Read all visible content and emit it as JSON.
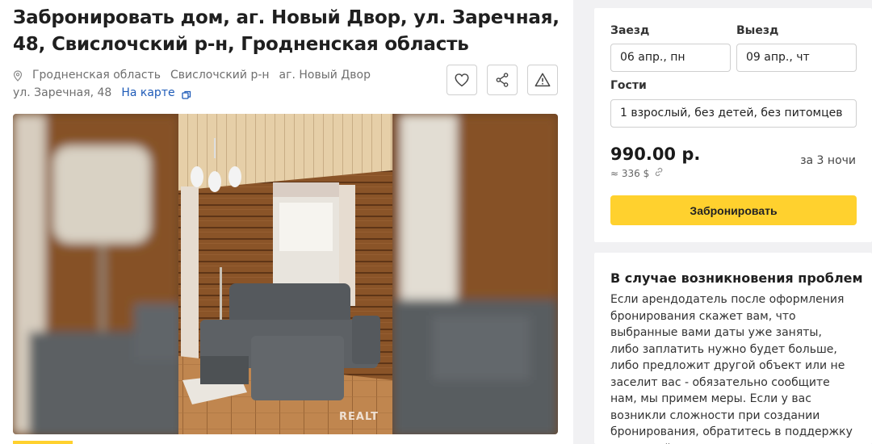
{
  "listing": {
    "title": "Забронировать дом, аг. Новый Двор, ул. Заречная, 48, Свислочский р-н, Гродненская область",
    "address": {
      "region": "Гродненская область",
      "district": "Свислочский р-н",
      "settlement": "аг. Новый Двор",
      "street": "ул. Заречная, 48",
      "map_link": "На карте"
    },
    "actions": [
      "heart-icon",
      "share-icon",
      "warning-icon"
    ],
    "watermark": "REALT"
  },
  "booking": {
    "checkin_label": "Заезд",
    "checkin_value": "06 апр., пн",
    "checkout_label": "Выезд",
    "checkout_value": "09 апр., чт",
    "guests_label": "Гости",
    "guests_value": "1 взрослый, без детей, без питомцев",
    "price": "990.00 р.",
    "price_usd": "≈ 336 $",
    "nights": "за 3 ночи",
    "book_button": "Забронировать"
  },
  "problems": {
    "title": "В случае возникновения проблем",
    "text": "Если арендодатель после оформления бронирования скажет вам, что выбранные вами даты уже заняты, либо заплатить нужно будет больше, либо предложит другой объект или не заселит вас - обязательно сообщите нам, мы примем меры. Если у вас возникли сложности при создании бронирования, обратитесь в поддержку прямо сейчас"
  },
  "colors": {
    "accent": "#ffd12e",
    "link": "#1e5bb8",
    "background": "#f1f1f3"
  }
}
